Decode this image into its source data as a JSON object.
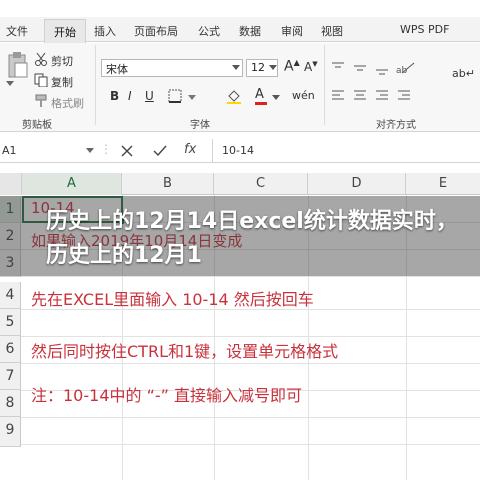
{
  "tabs": [
    "文件",
    "开始",
    "插入",
    "页面布局",
    "公式",
    "数据",
    "审阅",
    "视图",
    "WPS PDF"
  ],
  "ribbon": {
    "clipboard": {
      "cut": "剪切",
      "copy": "复制",
      "format_painter": "格式刷",
      "group": "剪贴板"
    },
    "font": {
      "name": "宋体",
      "size": "12",
      "group": "字体"
    },
    "align": {
      "group": "对齐方式"
    }
  },
  "formula_bar": {
    "cell_ref": "A1",
    "value": "10-14"
  },
  "columns": [
    "A",
    "B",
    "C",
    "D",
    "E"
  ],
  "rows": [
    "1",
    "2",
    "3",
    "4",
    "5",
    "6",
    "7",
    "8",
    "9"
  ],
  "cells": {
    "a1": "10-14",
    "a2": "如果输入2019年10月14日变成",
    "a4": "先在EXCEL里面输入 10-14 然后按回车",
    "a6": "然后同时按住CTRL和1键，设置单元格格式",
    "a8": "注：10-14中的 “-” 直接输入减号即可"
  },
  "overlay_title": "历史上的12月14日excel统计数据实时，历史上的12月1",
  "colors": {
    "accent": "#217346",
    "cell_text": "#c8323c"
  }
}
